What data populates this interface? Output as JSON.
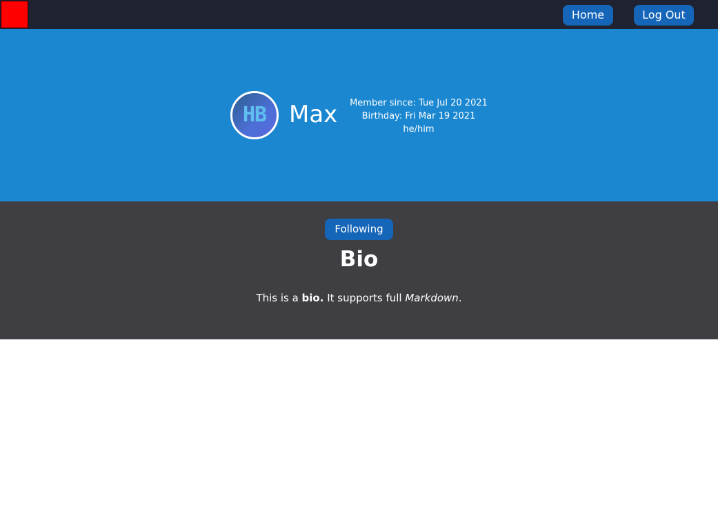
{
  "navbar": {
    "logo_color": "#ff0000",
    "home_label": "Home",
    "logout_label": "Log Out"
  },
  "profile": {
    "avatar_letters": "HB",
    "name": "Max",
    "member_since": "Member since: Tue Jul 20 2021",
    "birthday": "Birthday: Fri Mar 19 2021",
    "pronouns": "he/him"
  },
  "bio": {
    "follow_label": "Following",
    "heading": "Bio",
    "text_part1": "This is a ",
    "text_bold": "bio.",
    "text_part2": " It supports full ",
    "text_italic": "Markdown",
    "text_part3": "."
  },
  "colors": {
    "navbar_bg": "#1f2230",
    "hero_bg": "#1a87d0",
    "bio_bg": "#3f3e42",
    "button_bg": "#1565b8"
  }
}
